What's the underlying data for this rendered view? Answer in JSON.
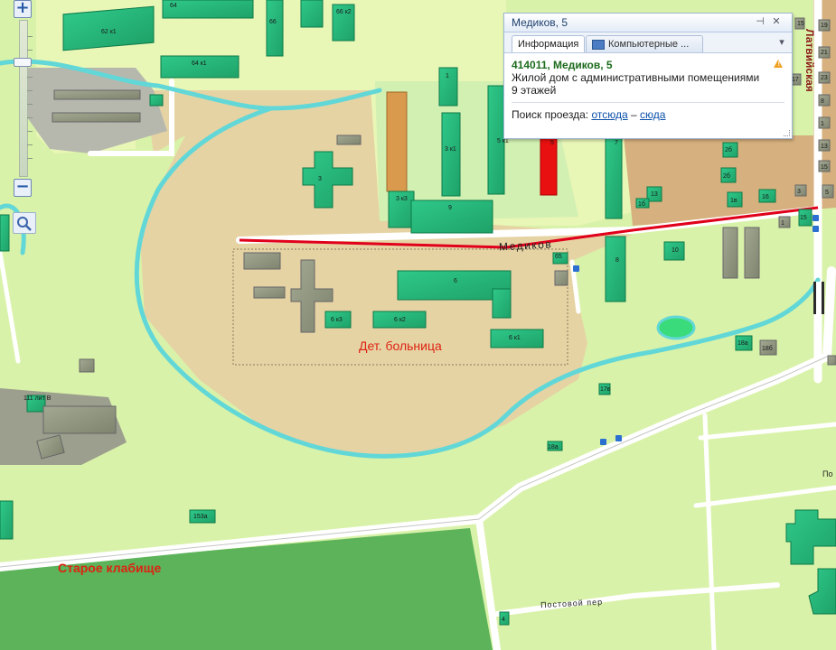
{
  "map": {
    "area_labels": {
      "hospital": "Дет. больница",
      "cemetery": "Старое клабище"
    },
    "streets": {
      "medikov": "Медиков",
      "latviiskaya": "Латвийская",
      "postovoi": "Постовой пер",
      "po_partial": "По"
    },
    "buildings": [
      "62 к1",
      "64",
      "66",
      "66 к2",
      "64 к1",
      "1",
      "3 к1",
      "5 к1",
      "5",
      "7",
      "3",
      "3 к3",
      "9",
      "6",
      "6 к3",
      "6 к2",
      "6 к1",
      "65",
      "8",
      "10",
      "13",
      "16",
      "15",
      "17",
      "19",
      "21",
      "23",
      "2б",
      "2б",
      "1в",
      "1б",
      "3",
      "5",
      "15",
      "8",
      "1",
      "13",
      "15",
      "1",
      "18а",
      "18б",
      "17в",
      "18а",
      "111 лит В",
      "153а",
      "4"
    ],
    "colors": {
      "road_highlight": "#e0001b",
      "selected_building": "#e81010",
      "accent_text": "#dd2211"
    }
  },
  "popup": {
    "title": "Медиков, 5",
    "tabs": [
      "Информация",
      "Компьютерные ..."
    ],
    "address": "414011, Медиков, 5",
    "description": "Жилой дом с административными помещениями",
    "floors": "9 этажей",
    "route_label": "Поиск проезда:",
    "route_from": "отсюда",
    "route_dash": "–",
    "route_to": "сюда"
  },
  "controls": {
    "zoom_in": "+",
    "zoom_out": "−"
  }
}
